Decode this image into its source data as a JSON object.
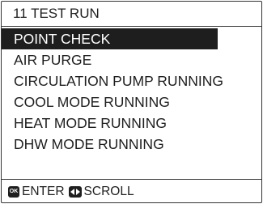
{
  "header": {
    "title": "11 TEST RUN"
  },
  "menu": {
    "items": [
      {
        "label": "POINT CHECK",
        "selected": true
      },
      {
        "label": "AIR PURGE",
        "selected": false
      },
      {
        "label": "CIRCULATION PUMP RUNNING",
        "selected": false
      },
      {
        "label": "COOL MODE RUNNING",
        "selected": false
      },
      {
        "label": "HEAT MODE RUNNING",
        "selected": false
      },
      {
        "label": "DHW MODE RUNNING",
        "selected": false
      }
    ]
  },
  "footer": {
    "ok_key_text": "OK",
    "ok_label": "ENTER",
    "scroll_key_icon": "left-right-arrows-icon",
    "scroll_label": "SCROLL"
  },
  "colors": {
    "highlight_background": "#1e1e1e",
    "highlight_text": "#ffffff",
    "text": "#1e1e1e",
    "border": "#333333"
  }
}
